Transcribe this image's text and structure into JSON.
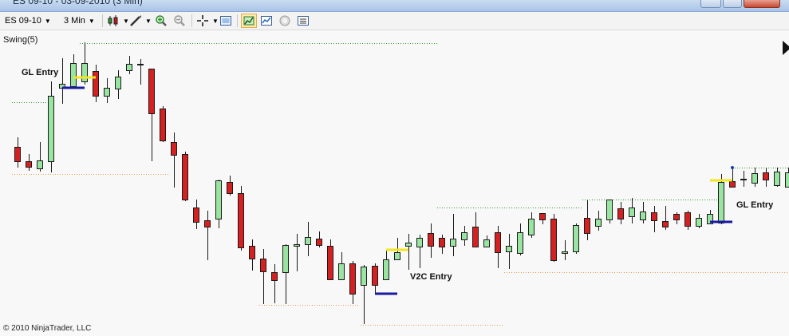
{
  "window": {
    "title": "ES 09-10 - 03-09-2010 (3 Min)"
  },
  "toolbar": {
    "instrument": "ES 09-10",
    "interval": "3 Min",
    "icons": [
      "candlestick-style-icon",
      "drawing-tools-icon",
      "zoom-in-icon",
      "zoom-out-icon",
      "crosshair-icon",
      "properties-icon",
      "strategies-icon",
      "indicators-icon",
      "chart-trader-icon",
      "data-box-icon"
    ]
  },
  "chart": {
    "indicator_label": "Swing(5)",
    "copyright": "© 2010 NinjaTrader, LLC",
    "annotations": {
      "gl_entry_1": "GL Entry",
      "v2c_entry": "V2C Entry",
      "gl_entry_2": "GL Entry"
    },
    "colors": {
      "up": "#98e4a0",
      "down": "#d42020",
      "wick": "#1a1a1a",
      "swing_high": "#3a9a3a",
      "swing_low": "#e0a050",
      "entry_yellow": "#f4e61e",
      "entry_blue": "#1a1aa0"
    }
  }
}
